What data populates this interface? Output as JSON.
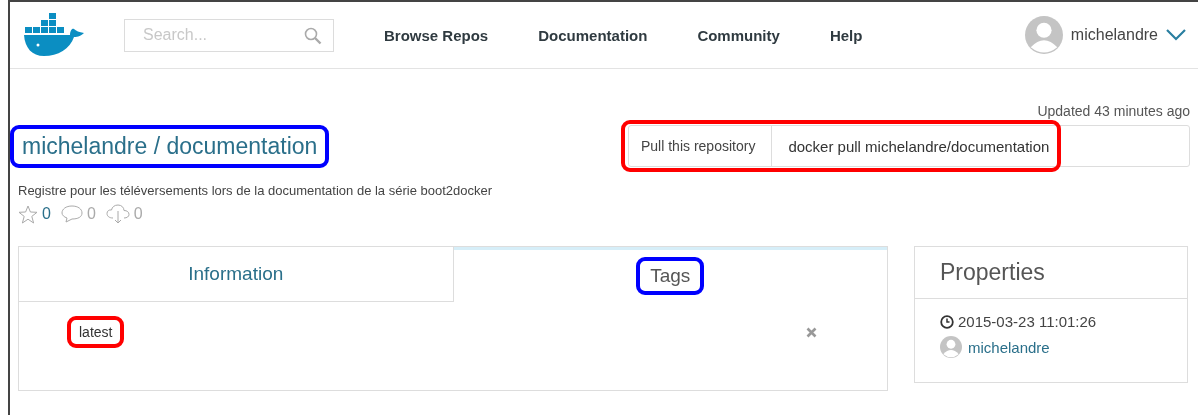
{
  "nav": {
    "search": {
      "placeholder": "Search..."
    },
    "links": [
      {
        "label": "Browse Repos"
      },
      {
        "label": "Documentation"
      },
      {
        "label": "Community"
      },
      {
        "label": "Help"
      }
    ],
    "user": "michelandre"
  },
  "repo": {
    "updated": "Updated 43 minutes ago",
    "title": {
      "text": "michelandre / documentation",
      "color": "#0000ff"
    },
    "pull": {
      "label": "Pull this repository",
      "command": "docker pull michelandre/documentation",
      "color": "#ff0000"
    },
    "description": "Registre pour les téléversements lors de la documentation de la série boot2docker",
    "stats": [
      {
        "kind": "stars",
        "count": "0"
      },
      {
        "kind": "comments",
        "count": "0"
      },
      {
        "kind": "downloads",
        "count": "0"
      }
    ]
  },
  "tabs": [
    {
      "label": "Information",
      "selected": false
    },
    {
      "label": "Tags",
      "selected": true,
      "color": "#0000ff"
    }
  ],
  "tags": [
    {
      "name": "latest",
      "color": "#ff0000"
    }
  ],
  "properties": {
    "title": "Properties",
    "date": "2015-03-23 11:01:26",
    "owner": "michelandre"
  }
}
